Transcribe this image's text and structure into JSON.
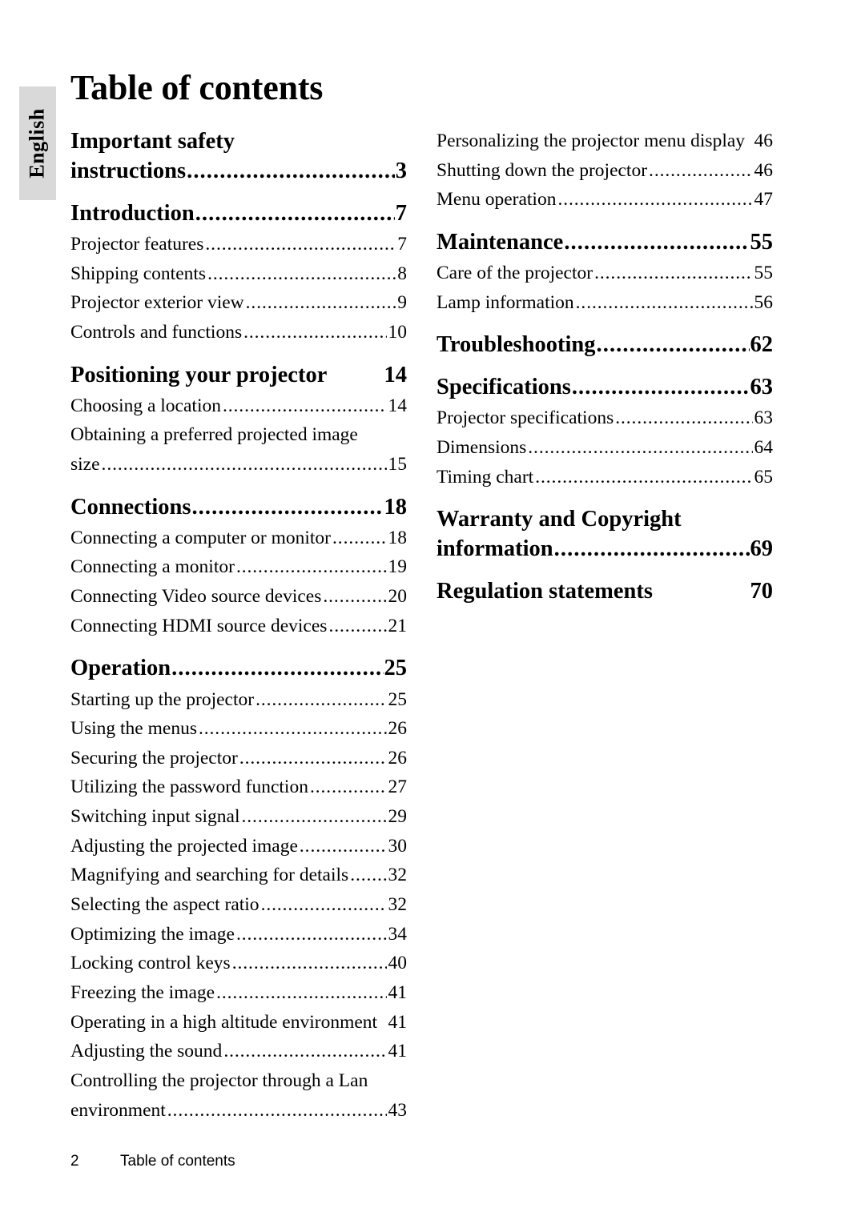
{
  "side_tab": {
    "label": "English"
  },
  "page_title": "Table of contents",
  "footer": {
    "page_number": "2",
    "text": "Table of contents"
  },
  "columns": {
    "left": [
      {
        "type": "major",
        "lines": [
          "Important safety",
          "instructions"
        ],
        "page": "3"
      },
      {
        "type": "major",
        "lines": [
          "Introduction"
        ],
        "page": "7"
      },
      {
        "type": "minor",
        "lines": [
          "Projector features"
        ],
        "page": "7"
      },
      {
        "type": "minor",
        "lines": [
          "Shipping contents"
        ],
        "page": "8"
      },
      {
        "type": "minor",
        "lines": [
          "Projector exterior view"
        ],
        "page": "9"
      },
      {
        "type": "minor",
        "lines": [
          "Controls and functions"
        ],
        "page": "10"
      },
      {
        "type": "major",
        "lines": [
          "Positioning your projector"
        ],
        "page": "14",
        "nodots": true
      },
      {
        "type": "minor",
        "lines": [
          "Choosing a location"
        ],
        "page": "14"
      },
      {
        "type": "minor",
        "lines": [
          "Obtaining a preferred projected image",
          "size"
        ],
        "page": "15"
      },
      {
        "type": "major",
        "lines": [
          "Connections"
        ],
        "page": "18"
      },
      {
        "type": "minor",
        "lines": [
          "Connecting a computer or monitor"
        ],
        "page": "18"
      },
      {
        "type": "minor",
        "lines": [
          "Connecting a monitor"
        ],
        "page": "19"
      },
      {
        "type": "minor",
        "lines": [
          "Connecting Video source devices"
        ],
        "page": "20"
      },
      {
        "type": "minor",
        "lines": [
          "Connecting HDMI source devices"
        ],
        "page": "21"
      },
      {
        "type": "major",
        "lines": [
          "Operation"
        ],
        "page": "25"
      },
      {
        "type": "minor",
        "lines": [
          "Starting up the projector"
        ],
        "page": "25"
      },
      {
        "type": "minor",
        "lines": [
          "Using the menus"
        ],
        "page": "26"
      },
      {
        "type": "minor",
        "lines": [
          "Securing the projector"
        ],
        "page": "26"
      },
      {
        "type": "minor",
        "lines": [
          "Utilizing the password function"
        ],
        "page": "27"
      },
      {
        "type": "minor",
        "lines": [
          "Switching input signal"
        ],
        "page": "29"
      },
      {
        "type": "minor",
        "lines": [
          "Adjusting the projected image"
        ],
        "page": "30"
      },
      {
        "type": "minor",
        "lines": [
          "Magnifying and searching for details"
        ],
        "page": "32"
      },
      {
        "type": "minor",
        "lines": [
          "Selecting the aspect ratio"
        ],
        "page": "32"
      },
      {
        "type": "minor",
        "lines": [
          "Optimizing the image"
        ],
        "page": "34"
      },
      {
        "type": "minor",
        "lines": [
          "Locking control keys"
        ],
        "page": "40"
      },
      {
        "type": "minor",
        "lines": [
          "Freezing the image"
        ],
        "page": "41"
      },
      {
        "type": "minor",
        "lines": [
          "Operating in a high altitude environment"
        ],
        "page": "41",
        "nodots": true
      },
      {
        "type": "minor",
        "lines": [
          "Adjusting the sound"
        ],
        "page": "41"
      },
      {
        "type": "minor",
        "lines": [
          "Controlling the projector through a Lan",
          "environment"
        ],
        "page": "43"
      }
    ],
    "right": [
      {
        "type": "minor",
        "lines": [
          "Personalizing the projector menu display"
        ],
        "page": "46",
        "nodots": true
      },
      {
        "type": "minor",
        "lines": [
          "Shutting down the projector"
        ],
        "page": "46"
      },
      {
        "type": "minor",
        "lines": [
          "Menu operation"
        ],
        "page": "47"
      },
      {
        "type": "major",
        "lines": [
          "Maintenance"
        ],
        "page": "55"
      },
      {
        "type": "minor",
        "lines": [
          "Care of the projector"
        ],
        "page": "55"
      },
      {
        "type": "minor",
        "lines": [
          "Lamp information"
        ],
        "page": "56"
      },
      {
        "type": "major",
        "lines": [
          "Troubleshooting"
        ],
        "page": "62"
      },
      {
        "type": "major",
        "lines": [
          "Specifications"
        ],
        "page": "63"
      },
      {
        "type": "minor",
        "lines": [
          "Projector specifications"
        ],
        "page": "63"
      },
      {
        "type": "minor",
        "lines": [
          "Dimensions"
        ],
        "page": "64"
      },
      {
        "type": "minor",
        "lines": [
          "Timing chart"
        ],
        "page": "65"
      },
      {
        "type": "major",
        "lines": [
          "Warranty and Copyright",
          "information"
        ],
        "page": "69"
      },
      {
        "type": "major",
        "lines": [
          "Regulation statements"
        ],
        "page": "70",
        "nodots": true
      }
    ]
  }
}
